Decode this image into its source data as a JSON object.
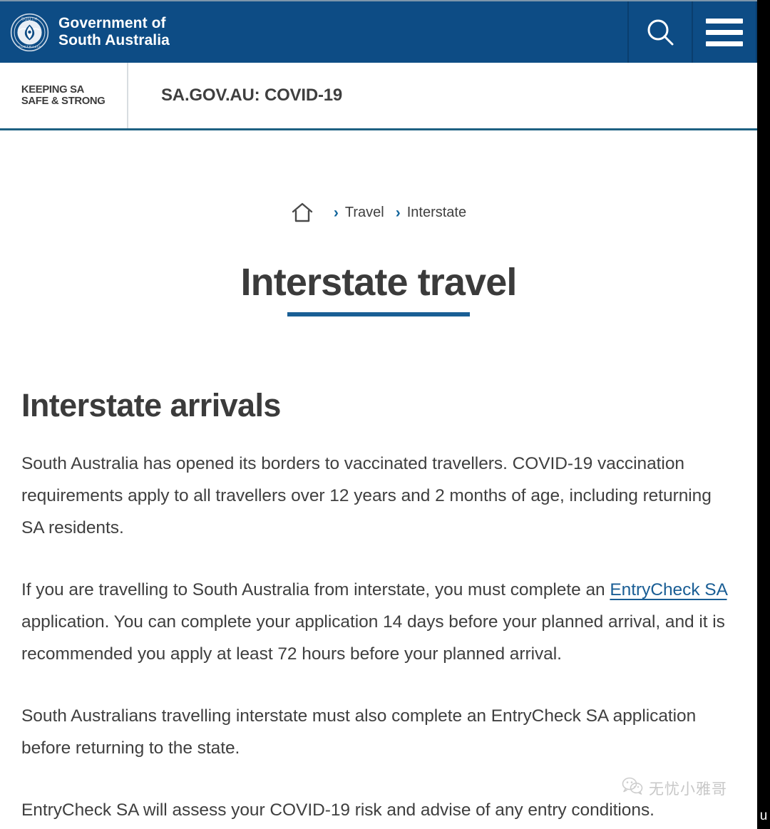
{
  "colors": {
    "header_blue": "#0d4c85",
    "accent_blue": "#1a5f95",
    "link_blue": "#1a5e95",
    "subnav_border": "#1e6182",
    "text_dark": "#3f3f3f",
    "band_black": "#000000"
  },
  "header": {
    "logo_icon": "sa-government-crest-icon",
    "brand_line1": "Government of",
    "brand_line2": "South Australia",
    "brand_text": "Government of\nSouth Australia",
    "search_icon": "search-icon",
    "search_label": "Search",
    "menu_icon": "hamburger-menu-icon",
    "menu_label": "Menu"
  },
  "subnav": {
    "badge_line1": "KEEPING SA",
    "badge_line2": "SAFE & STRONG",
    "badge_text": "KEEPING SA\nSAFE & STRONG",
    "site_title": "SA.GOV.AU: COVID-19"
  },
  "breadcrumb": {
    "home_icon": "home-icon",
    "home_label": "Home",
    "separator": "›",
    "items": [
      {
        "label": "Travel"
      },
      {
        "label": "Interstate"
      }
    ]
  },
  "hero": {
    "title": "Interstate travel"
  },
  "main": {
    "heading": "Interstate arrivals",
    "paragraphs": [
      "South Australia has opened its borders to vaccinated travellers. COVID-19 vaccination requirements apply to all travellers over 12 years and 2 months of age, including returning SA residents.",
      "South Australians travelling interstate must also complete an EntryCheck SA application before returning to the state.",
      "EntryCheck SA will assess your COVID-19 risk and advise of any entry conditions."
    ],
    "linked_paragraph": {
      "before": "If you are travelling to South Australia from interstate, you must complete an ",
      "link_text": "EntryCheck SA",
      "after": " application. You can complete your application 14 days before your planned arrival, and it is recommended you apply at least 72 hours before your planned arrival."
    }
  },
  "overlay": {
    "watermark_icon": "wechat-icon",
    "watermark_text": "无忧小雅哥",
    "band_glyph": "u"
  }
}
